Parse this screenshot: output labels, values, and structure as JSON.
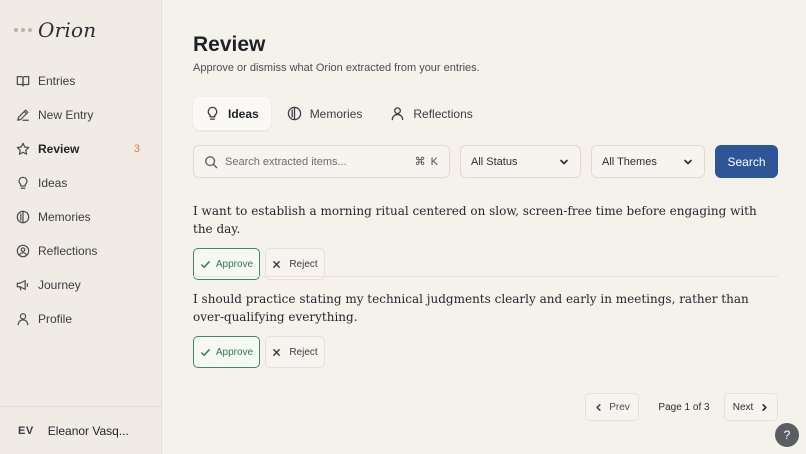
{
  "brand": {
    "name": "Orion"
  },
  "sidebar": {
    "items": [
      {
        "label": "Entries",
        "icon": "book-icon"
      },
      {
        "label": "New Entry",
        "icon": "pencil-icon"
      },
      {
        "label": "Review",
        "icon": "star-icon",
        "badge": "3",
        "active": true
      },
      {
        "label": "Ideas",
        "icon": "lightbulb-icon"
      },
      {
        "label": "Memories",
        "icon": "memories-icon"
      },
      {
        "label": "Reflections",
        "icon": "reflections-icon"
      },
      {
        "label": "Journey",
        "icon": "journey-icon"
      },
      {
        "label": "Profile",
        "icon": "person-icon"
      }
    ],
    "user": {
      "initials": "EV",
      "name": "Eleanor Vasq..."
    }
  },
  "page": {
    "title": "Review",
    "subtitle": "Approve or dismiss what Orion extracted from your entries."
  },
  "tabs": [
    {
      "label": "Ideas",
      "icon": "lightbulb-icon",
      "active": true
    },
    {
      "label": "Memories",
      "icon": "memories-icon"
    },
    {
      "label": "Reflections",
      "icon": "person-icon"
    }
  ],
  "filters": {
    "search_placeholder": "Search extracted items...",
    "shortcut": "⌘ K",
    "status": "All Status",
    "themes": "All Themes",
    "search_button": "Search"
  },
  "items": [
    {
      "text": "I want to establish a morning ritual centered on slow, screen-free time before engaging with the day."
    },
    {
      "text": "I should practice stating my technical judgments clearly and early in meetings, rather than over-qualifying everything."
    }
  ],
  "actions": {
    "approve": "Approve",
    "reject": "Reject"
  },
  "pagination": {
    "prev": "Prev",
    "info": "Page 1 of 3",
    "next": "Next"
  },
  "help": {
    "label": "?"
  },
  "colors": {
    "accent": "#2e5597",
    "approve": "#2f7a4f",
    "badge": "#e07a3f"
  }
}
